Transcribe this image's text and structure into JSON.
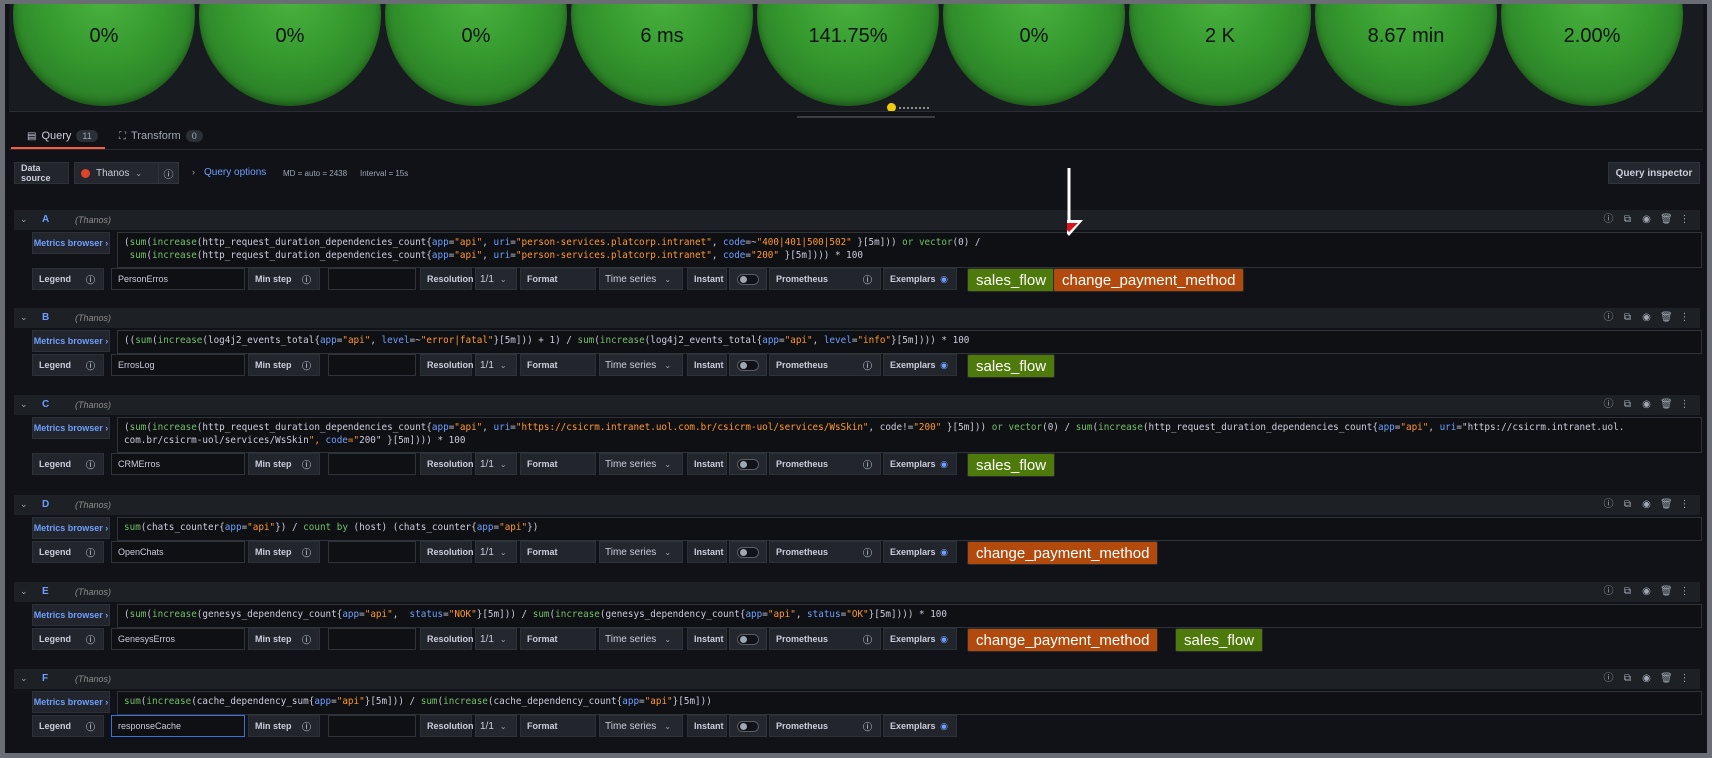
{
  "stats": [
    "0%",
    "0%",
    "0%",
    "6 ms",
    "141.75%",
    "0%",
    "2 K",
    "8.67 min",
    "2.00%"
  ],
  "tabs": {
    "query_label": "Query",
    "query_count": "11",
    "transform_label": "Transform",
    "transform_count": "0"
  },
  "datasource": {
    "label": "Data source",
    "name": "Thanos",
    "query_options": "Query options",
    "md": "MD = auto = 2438",
    "interval": "Interval = 15s",
    "inspector": "Query inspector"
  },
  "labels": {
    "metrics_browser": "Metrics browser",
    "legend": "Legend",
    "min_step": "Min step",
    "resolution": "Resolution",
    "resolution_value": "1/1",
    "format": "Format",
    "format_value": "Time series",
    "instant": "Instant",
    "prometheus": "Prometheus",
    "exemplars": "Exemplars"
  },
  "queries": [
    {
      "name": "A",
      "ds": "(Thanos)",
      "legend": "PersonErros",
      "tags": [
        "sales_flow",
        "change_payment_method"
      ]
    },
    {
      "name": "B",
      "ds": "(Thanos)",
      "legend": "ErrosLog",
      "tags": [
        "sales_flow"
      ]
    },
    {
      "name": "C",
      "ds": "(Thanos)",
      "legend": "CRMErros",
      "tags": [
        "sales_flow"
      ]
    },
    {
      "name": "D",
      "ds": "(Thanos)",
      "legend": "OpenChats",
      "tags": [
        "change_payment_method"
      ]
    },
    {
      "name": "E",
      "ds": "(Thanos)",
      "legend": "GenesysErros",
      "tags": [
        "change_payment_method",
        "sales_flow"
      ]
    },
    {
      "name": "F",
      "ds": "(Thanos)",
      "legend": "responseCache",
      "tags": []
    }
  ],
  "expr": {
    "a1": "(sum(increase(http_request_duration_dependencies_count{app=\"api\", uri=\"person-services.platcorp.intranet\", code=~\"400|401|500|502\" }[5m])) or vector(0) /",
    "a2": " sum(increase(http_request_duration_dependencies_count{app=\"api\", uri=\"person-services.platcorp.intranet\", code=\"200\" }[5m]))) * 100",
    "b1": "((sum(increase(log4j2_events_total{app=\"api\", level=~\"error|fatal\"}[5m])) + 1) / sum(increase(log4j2_events_total{app=\"api\", level=\"info\"}[5m]))) * 100",
    "c1": "(sum(increase(http_request_duration_dependencies_count{app=\"api\", uri=\"https://csicrm.intranet.uol.com.br/csicrm-uol/services/WsSkin\", code!=\"200\" }[5m])) or vector(0) / sum(increase(http_request_duration_dependencies_count{app=\"api\", uri=\"https://csicrm.intranet.uol.",
    "c2": "com.br/csicrm-uol/services/WsSkin\", code=\"200\" }[5m]))) * 100",
    "d1": "sum(chats_counter{app=\"api\"}) / count by (host) (chats_counter{app=\"api\"})",
    "e1": "(sum(increase(genesys_dependency_count{app=\"api\",  status=\"NOK\"}[5m])) / sum(increase(genesys_dependency_count{app=\"api\", status=\"OK\"}[5m]))) * 100",
    "f1": "sum(increase(cache_dependency_sum{app=\"api\"}[5m])) / sum(increase(cache_dependency_count{app=\"api\"}[5m]))"
  },
  "colors": {
    "accent": "#6e9fff",
    "tab_active": "#f55f3e",
    "tag_green": "#4d7a0a",
    "tag_orange": "#b24a0d",
    "stat_green": "#35992e"
  }
}
